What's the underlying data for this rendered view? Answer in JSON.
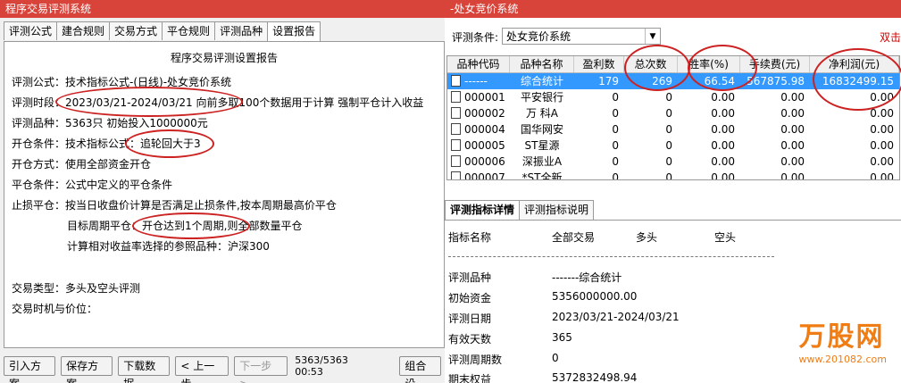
{
  "left_window": {
    "title": "程序交易评测系统",
    "tabs": [
      "评测公式",
      "建合规则",
      "交易方式",
      "平仓规则",
      "评测品种",
      "设置报告"
    ],
    "active_tab": 5,
    "report": {
      "title": "程序交易评测设置报告",
      "lines": [
        "评测公式：技术指标公式-(日线)-处女竞价系统",
        "评测时段：2023/03/21-2024/03/21 向前多取100个数据用于计算 强制平仓计入收益",
        "评测品种：5363只 初始投入1000000元",
        "开仓条件：技术指标公式：追轮回大于3",
        "开仓方式：使用全部资金开仓",
        "平仓条件：公式中定义的平仓条件",
        "止损平仓：按当日收盘价计算是否满足止损条件,按本周期最高价平仓"
      ],
      "sub_lines": [
        "目标周期平仓：开仓达到1个周期,则全部数量平仓",
        "计算相对收益率选择的参照品种：沪深300"
      ],
      "tail_lines": [
        "交易类型：多头及空头评测",
        "交易时机与价位："
      ]
    },
    "buttons": {
      "import": "引入方案",
      "save": "保存方案",
      "download": "下载数据",
      "prev": "< 上一步",
      "next": "下一步 >",
      "status": "5363/5363 00:53",
      "combo": "组合设"
    }
  },
  "right_window": {
    "title": "-处女竞价系统",
    "cond_label": "评测条件:",
    "cond_value": "处女竞价系统",
    "double_click": "双击",
    "columns": [
      "品种代码",
      "品种名称",
      "盈利数",
      "总次数",
      "胜率(%)",
      "手续费(元)",
      "净利润(元)"
    ],
    "rows": [
      [
        "------",
        "综合统计",
        "179",
        "269",
        "66.54",
        "567875.98",
        "16832499.15"
      ],
      [
        "000001",
        "平安银行",
        "0",
        "0",
        "0.00",
        "0.00",
        "0.00"
      ],
      [
        "000002",
        "万 科A",
        "0",
        "0",
        "0.00",
        "0.00",
        "0.00"
      ],
      [
        "000004",
        "国华网安",
        "0",
        "0",
        "0.00",
        "0.00",
        "0.00"
      ],
      [
        "000005",
        "ST星源",
        "0",
        "0",
        "0.00",
        "0.00",
        "0.00"
      ],
      [
        "000006",
        "深振业A",
        "0",
        "0",
        "0.00",
        "0.00",
        "0.00"
      ],
      [
        "000007",
        "*ST全新",
        "0",
        "0",
        "0.00",
        "0.00",
        "0.00"
      ]
    ],
    "detail_tabs": [
      "评测指标详情",
      "评测指标说明"
    ],
    "detail_header": [
      "指标名称",
      "全部交易",
      "多头",
      "空头"
    ],
    "detail_rows": [
      [
        "评测品种",
        "-------综合统计"
      ],
      [
        "初始资金",
        "5356000000.00"
      ],
      [
        "评测日期",
        "2023/03/21-2024/03/21"
      ],
      [
        "有效天数",
        "365"
      ],
      [
        "评测周期数",
        "0"
      ],
      [
        "期末权益",
        "5372832498.94"
      ]
    ]
  },
  "watermark": {
    "text": "万股网",
    "url": "www.201082.com"
  },
  "colors": {
    "title_bar": "#d8433a",
    "selection": "#3399ff",
    "annotation": "#c22222",
    "logo": "#ef7d14"
  }
}
